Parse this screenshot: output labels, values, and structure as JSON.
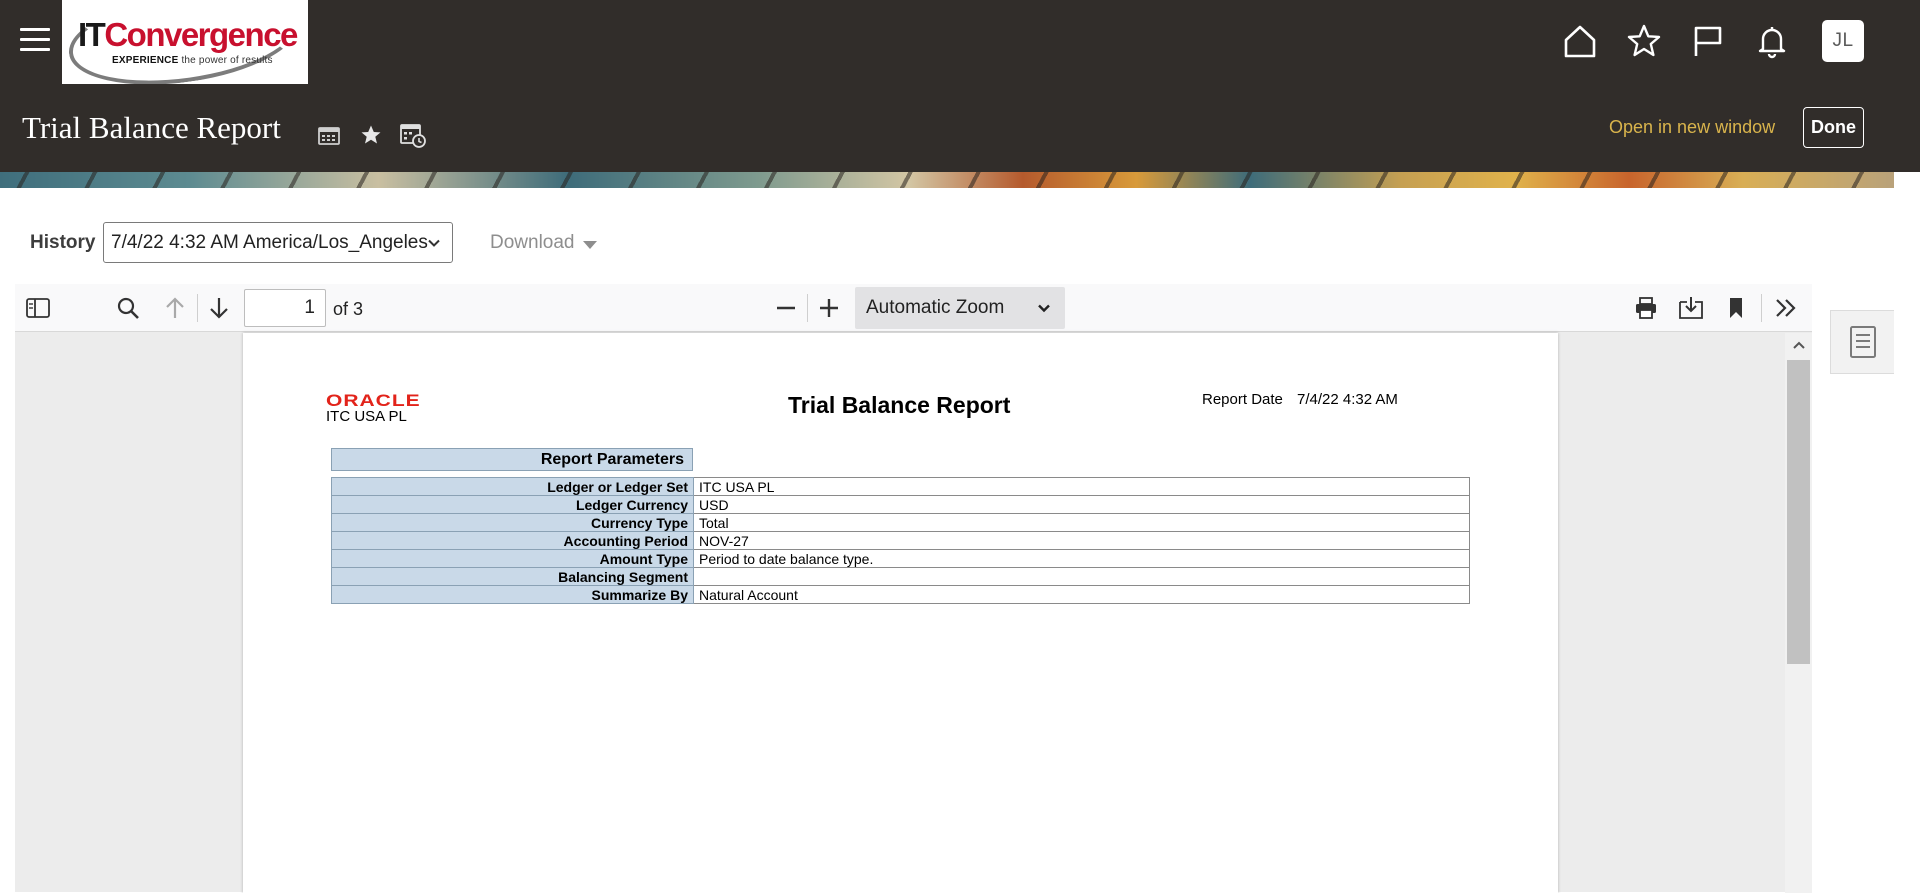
{
  "header": {
    "logo_text_it": "IT",
    "logo_text_conv": "Convergence",
    "logo_tag_bold": "EXPERIENCE",
    "logo_tag_rest": " the power of results",
    "avatar_initials": "JL",
    "page_title": "Trial Balance Report",
    "open_new_window": "Open in new window",
    "done_label": "Done",
    "icons": [
      "hamburger-menu-icon",
      "home-icon",
      "star-icon",
      "flag-icon",
      "bell-icon"
    ],
    "accent_link_color": "#d9b44c",
    "bar_color": "#312d2a"
  },
  "history": {
    "label": "History",
    "selected": "7/4/22 4:32 AM America/Los_Angeles",
    "download_label": "Download"
  },
  "viewer": {
    "page_number": "1",
    "page_count": "of 3",
    "zoom": "Automatic Zoom"
  },
  "report": {
    "oracle_logo": "ORACLE",
    "company": "ITC USA PL",
    "title": "Trial Balance Report",
    "date_label": "Report Date",
    "date_value": "7/4/22 4:32 AM",
    "params_heading": "Report Parameters",
    "params": [
      {
        "label": "Ledger or Ledger Set",
        "value": "ITC USA PL"
      },
      {
        "label": "Ledger Currency",
        "value": "USD"
      },
      {
        "label": "Currency Type",
        "value": "Total"
      },
      {
        "label": "Accounting Period",
        "value": "NOV-27"
      },
      {
        "label": "Amount Type",
        "value": "Period to date balance type."
      },
      {
        "label": "Balancing Segment",
        "value": ""
      },
      {
        "label": "Summarize By",
        "value": "Natural Account"
      }
    ]
  }
}
